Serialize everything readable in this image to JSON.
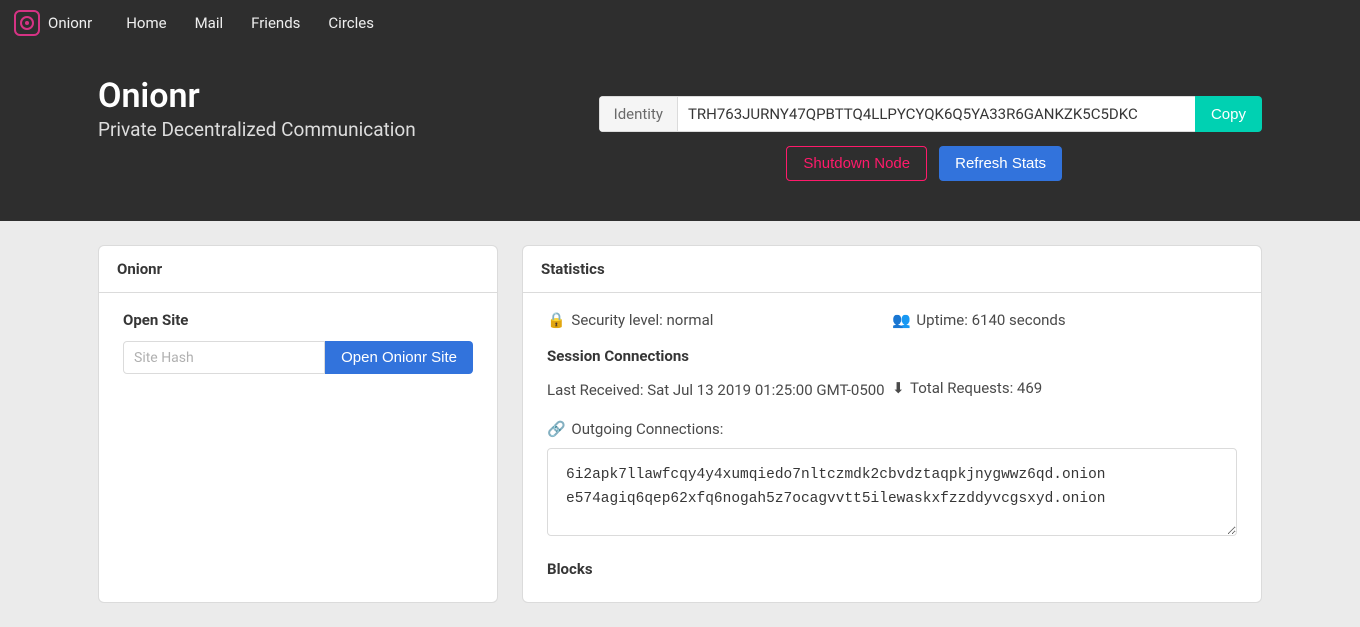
{
  "navbar": {
    "brand": "Onionr",
    "links": [
      "Home",
      "Mail",
      "Friends",
      "Circles"
    ]
  },
  "hero": {
    "title": "Onionr",
    "subtitle": "Private Decentralized Communication",
    "identity_label": "Identity",
    "identity_value": "TRH763JURNY47QPBTTQ4LLPYCYQK6Q5YA33R6GANKZK5C5DKC",
    "copy_label": "Copy",
    "shutdown_label": "Shutdown Node",
    "refresh_label": "Refresh Stats"
  },
  "left_card": {
    "header": "Onionr",
    "open_site_label": "Open Site",
    "site_placeholder": "Site Hash",
    "open_button": "Open Onionr Site"
  },
  "stats": {
    "header": "Statistics",
    "security_icon": "🔒",
    "security_text": "Security level: normal",
    "uptime_icon": "👥",
    "uptime_text": "Uptime: 6140 seconds",
    "session_title": "Session Connections",
    "last_received_label": "  Last Received: Sat Jul 13 2019 01:25:00 GMT-0500",
    "total_requests_icon": "⬇",
    "total_requests_text": "Total Requests: 469",
    "outgoing_icon": "🔗",
    "outgoing_label": "Outgoing Connections:",
    "connections": "6i2apk7llawfcqy4y4xumqiedo7nltczmdk2cbvdztaqpkjnygwwz6qd.onion\ne574agiq6qep62xfq6nogah5z7ocagvvtt5ilewaskxfzzddyvcgsxyd.onion",
    "blocks_title": "Blocks"
  }
}
